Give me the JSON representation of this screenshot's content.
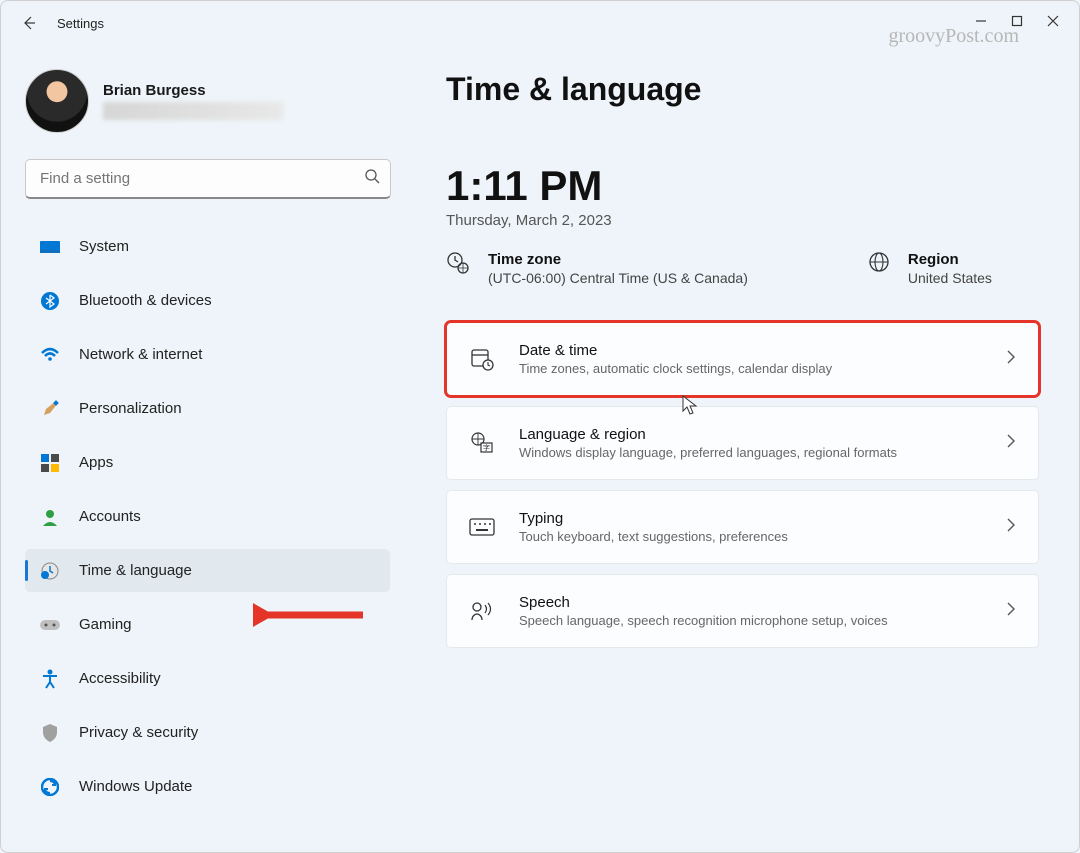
{
  "header": {
    "title": "Settings",
    "watermark": "groovyPost.com"
  },
  "profile": {
    "name": "Brian Burgess"
  },
  "search": {
    "placeholder": "Find a setting"
  },
  "sidebar": {
    "items": [
      {
        "label": "System"
      },
      {
        "label": "Bluetooth & devices"
      },
      {
        "label": "Network & internet"
      },
      {
        "label": "Personalization"
      },
      {
        "label": "Apps"
      },
      {
        "label": "Accounts"
      },
      {
        "label": "Time & language"
      },
      {
        "label": "Gaming"
      },
      {
        "label": "Accessibility"
      },
      {
        "label": "Privacy & security"
      },
      {
        "label": "Windows Update"
      }
    ]
  },
  "main": {
    "title": "Time & language",
    "clock": "1:11 PM",
    "date": "Thursday, March 2, 2023",
    "timezone": {
      "label": "Time zone",
      "value": "(UTC-06:00) Central Time (US & Canada)"
    },
    "region": {
      "label": "Region",
      "value": "United States"
    },
    "cards": [
      {
        "title": "Date & time",
        "sub": "Time zones, automatic clock settings, calendar display"
      },
      {
        "title": "Language & region",
        "sub": "Windows display language, preferred languages, regional formats"
      },
      {
        "title": "Typing",
        "sub": "Touch keyboard, text suggestions, preferences"
      },
      {
        "title": "Speech",
        "sub": "Speech language, speech recognition microphone setup, voices"
      }
    ]
  }
}
